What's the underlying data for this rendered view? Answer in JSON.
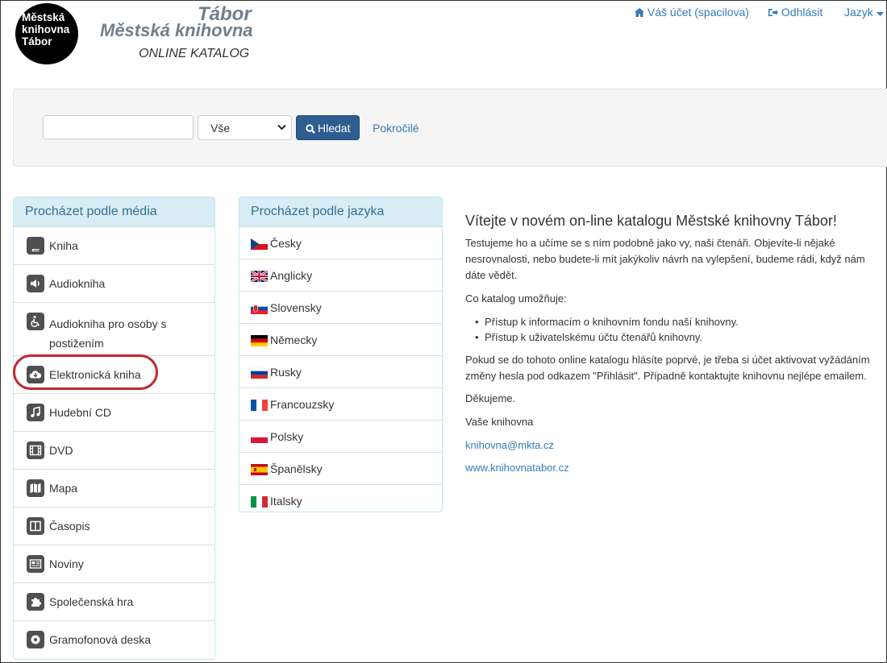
{
  "header": {
    "logo_line1": "Městská",
    "logo_line2": "knihovna",
    "logo_line3": "Tábor",
    "brand_city": "Tábor",
    "brand_library": "Městská knihovna",
    "brand_catalog": "ONLINE KATALOG",
    "account_label": "Váš účet (spacilova)",
    "logout_label": "Odhlásit",
    "language_label": "Jazyk"
  },
  "search": {
    "input_value": "",
    "select_value": "Vše",
    "button_label": "Hledat",
    "advanced_label": "Pokročilé"
  },
  "media_panel": {
    "title": "Procházet podle média",
    "items": [
      {
        "label": "Kniha",
        "icon": "book-icon"
      },
      {
        "label": "Audiokniha",
        "icon": "volume-icon"
      },
      {
        "label": "Audiokniha pro osoby s postižením",
        "icon": "wheelchair-icon"
      },
      {
        "label": "Elektronická kniha",
        "icon": "cloud-download-icon"
      },
      {
        "label": "Hudební CD",
        "icon": "music-icon"
      },
      {
        "label": "DVD",
        "icon": "film-icon"
      },
      {
        "label": "Mapa",
        "icon": "map-icon"
      },
      {
        "label": "Časopis",
        "icon": "columns-icon"
      },
      {
        "label": "Noviny",
        "icon": "newspaper-icon"
      },
      {
        "label": "Společenská hra",
        "icon": "puzzle-icon"
      },
      {
        "label": "Gramofonová deska",
        "icon": "record-icon"
      }
    ]
  },
  "language_panel": {
    "title": "Procházet podle jazyka",
    "items": [
      {
        "label": "Česky",
        "flag": "czech-flag-icon"
      },
      {
        "label": "Anglicky",
        "flag": "uk-flag-icon"
      },
      {
        "label": "Slovensky",
        "flag": "slovak-flag-icon"
      },
      {
        "label": "Německy",
        "flag": "german-flag-icon"
      },
      {
        "label": "Rusky",
        "flag": "russian-flag-icon"
      },
      {
        "label": "Francouzsky",
        "flag": "french-flag-icon"
      },
      {
        "label": "Polsky",
        "flag": "polish-flag-icon"
      },
      {
        "label": "Španělsky",
        "flag": "spanish-flag-icon"
      },
      {
        "label": "Italsky",
        "flag": "italian-flag-icon"
      }
    ]
  },
  "welcome": {
    "heading": "Vítejte v novém on-line katalogu Městské knihovny Tábor!",
    "intro_line1": "Testujeme ho a učíme se s ním podobně jako vy, naši čtenáři. Objevíte-li nějaké",
    "intro_line2": "nesrovnalosti, nebo budete-li mít jakýkoliv návrh na vylepšení, budeme rádi, když nám",
    "intro_line3": "dáte vědět.",
    "features_label": "Co katalog umožňuje:",
    "features": [
      "Přístup k informacím o knihovním fondu naší knihovny.",
      "Přístup k uživatelskému účtu čtenářů knihovny."
    ],
    "activation_line1": "Pokud se do tohoto online katalogu hlásíte poprvé, je třeba si účet aktivovat vyžádáním",
    "activation_line2": "změny hesla pod odkazem \"Přihlásit\". Případně kontaktujte knihovnu nejlépe emailem.",
    "thanks": "Děkujeme.",
    "signature": "Vaše knihovna",
    "email": "knihovna@mkta.cz",
    "website": "www.knihovnatabor.cz"
  },
  "colors": {
    "accent": "#337ab7",
    "button": "#2e5d92",
    "panel_heading_bg": "#d9edf7",
    "panel_heading_text": "#31708f",
    "highlight": "#c0282e"
  }
}
